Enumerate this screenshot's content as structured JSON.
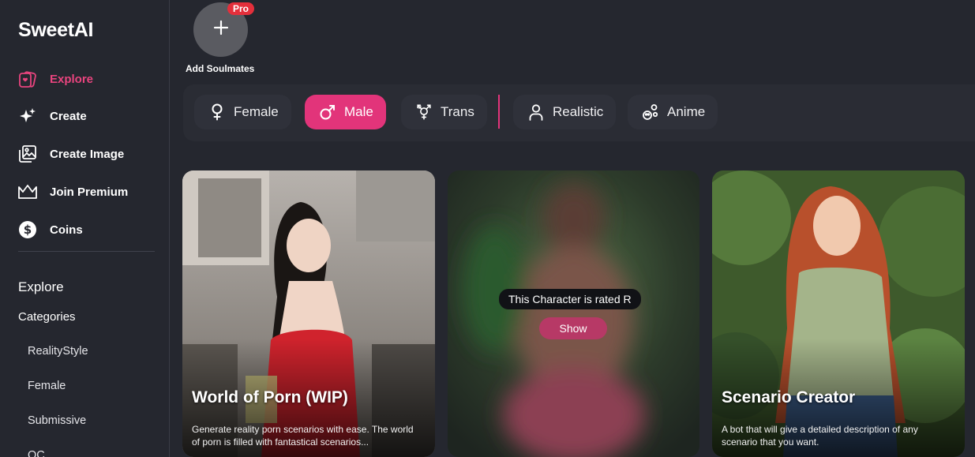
{
  "brand": "SweetAI",
  "nav": {
    "explore": "Explore",
    "create": "Create",
    "create_image": "Create Image",
    "join_premium": "Join Premium",
    "coins": "Coins"
  },
  "sidebar": {
    "section_title": "Explore",
    "categories_label": "Categories",
    "categories": [
      "RealityStyle",
      "Female",
      "Submissive",
      "OC"
    ]
  },
  "add_soulmates": {
    "label": "Add Soulmates",
    "badge": "Pro"
  },
  "filters": {
    "female": "Female",
    "male": "Male",
    "trans": "Trans",
    "realistic": "Realistic",
    "anime": "Anime"
  },
  "cards": [
    {
      "title": "World of Porn (WIP)",
      "description": "Generate reality porn scenarios with ease. The world of porn is filled with fantastical scenarios..."
    },
    {
      "rated_text": "This Character is rated R",
      "show_label": "Show"
    },
    {
      "title": "Scenario Creator",
      "description": "A bot that will give a detailed description of any scenario that you want."
    }
  ],
  "colors": {
    "accent": "#e2347a",
    "background": "#25272f",
    "badge": "#e42f3b"
  }
}
